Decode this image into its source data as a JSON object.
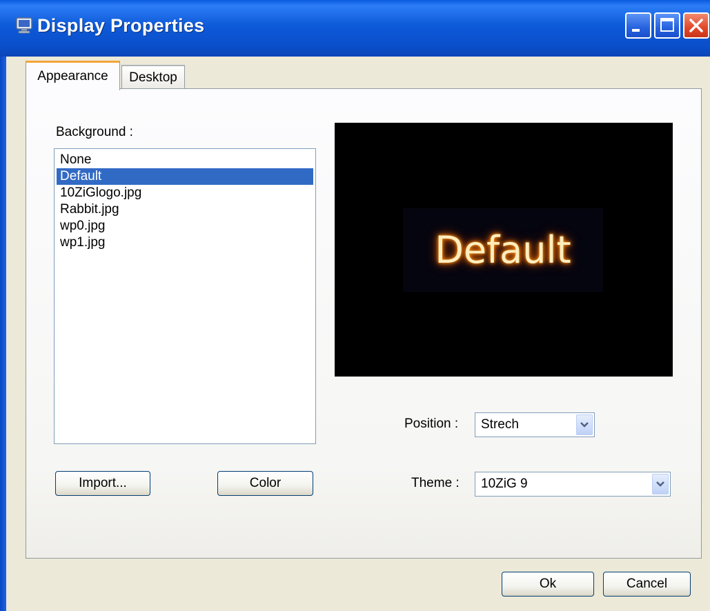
{
  "window": {
    "title": "Display Properties",
    "icon": "monitor-icon",
    "controls": {
      "minimize": "minimize-icon",
      "maximize": "maximize-icon",
      "close": "close-icon"
    }
  },
  "tabs": [
    {
      "label": "Appearance",
      "active": true
    },
    {
      "label": "Desktop",
      "active": false
    }
  ],
  "background": {
    "label": "Background :",
    "items": [
      "None",
      "Default",
      "10ZiGlogo.jpg",
      "Rabbit.jpg",
      "wp0.jpg",
      "wp1.jpg"
    ],
    "selected": "Default"
  },
  "preview": {
    "text": "Default"
  },
  "buttons": {
    "import": "Import...",
    "color": "Color",
    "ok": "Ok",
    "cancel": "Cancel"
  },
  "position": {
    "label": "Position :",
    "value": "Strech"
  },
  "theme": {
    "label": "Theme :",
    "value": "10ZiG 9"
  },
  "colors": {
    "titlebar": "#0a54d6",
    "selection": "#316ac5",
    "tab_highlight": "#f3a53b",
    "face": "#ece9d8"
  }
}
